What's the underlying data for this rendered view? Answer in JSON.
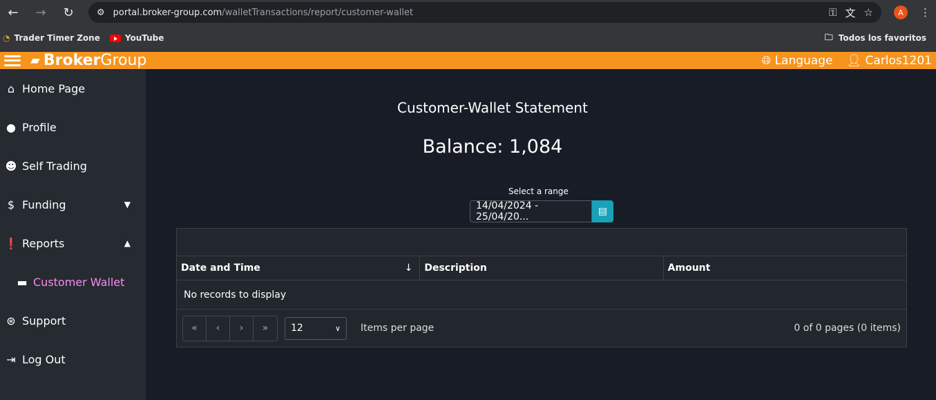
{
  "browser": {
    "url_host": "portal.broker-group.com",
    "url_path": "/walletTransactions/report/customer-wallet",
    "profile_initial": "A",
    "bookmarks": [
      {
        "label": "Trader Timer Zone"
      },
      {
        "label": "YouTube"
      }
    ],
    "all_bookmarks": "Todos los favoritos"
  },
  "header": {
    "logo_bold": "Broker",
    "logo_light": "Group",
    "language": "Language",
    "user": "Carlos1201"
  },
  "sidebar": {
    "items": [
      {
        "label": "Home Page"
      },
      {
        "label": "Profile"
      },
      {
        "label": "Self Trading"
      },
      {
        "label": "Funding"
      },
      {
        "label": "Reports"
      },
      {
        "label": "Customer Wallet"
      },
      {
        "label": "Support"
      },
      {
        "label": "Log Out"
      }
    ]
  },
  "main": {
    "title": "Customer-Wallet Statement",
    "balance": "Balance: 1,084",
    "range_label": "Select a range",
    "range_value": "14/04/2024 - 25/04/20...",
    "columns": [
      "Date and Time",
      "Description",
      "Amount"
    ],
    "empty": "No records to display",
    "pager": {
      "page_size": "12",
      "items_per_page": "Items per page",
      "info": "0 of 0 pages (0 items)"
    }
  }
}
